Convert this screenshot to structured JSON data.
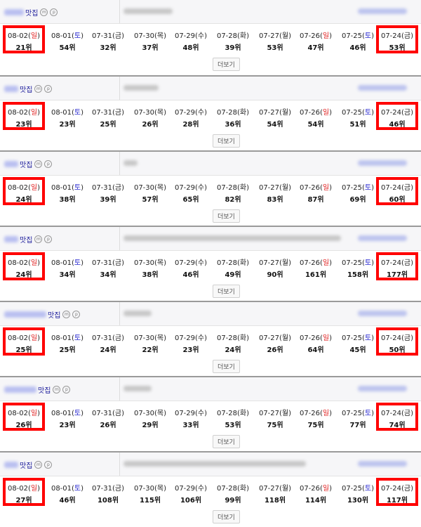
{
  "cards": [
    {
      "name_label": "맛집",
      "ranks": [
        "21위",
        "54위",
        "32위",
        "37위",
        "48위",
        "39위",
        "53위",
        "47위",
        "46위",
        "53위"
      ]
    },
    {
      "name_label": "맛집",
      "ranks": [
        "23위",
        "23위",
        "25위",
        "26위",
        "28위",
        "36위",
        "54위",
        "54위",
        "51위",
        "46위"
      ]
    },
    {
      "name_label": "맛집",
      "ranks": [
        "24위",
        "38위",
        "39위",
        "57위",
        "65위",
        "82위",
        "83위",
        "87위",
        "69위",
        "60위"
      ]
    },
    {
      "name_label": "맛집",
      "ranks": [
        "24위",
        "34위",
        "34위",
        "38위",
        "46위",
        "49위",
        "90위",
        "161위",
        "158위",
        "177위"
      ]
    },
    {
      "name_label": "맛집",
      "ranks": [
        "25위",
        "25위",
        "24위",
        "22위",
        "23위",
        "24위",
        "26위",
        "64위",
        "45위",
        "50위"
      ]
    },
    {
      "name_label": "맛집",
      "ranks": [
        "26위",
        "23위",
        "26위",
        "29위",
        "33위",
        "53위",
        "75위",
        "75위",
        "77위",
        "74위"
      ]
    },
    {
      "name_label": "맛집",
      "ranks": [
        "27위",
        "46위",
        "108위",
        "115위",
        "106위",
        "99위",
        "118위",
        "114위",
        "130위",
        "117위"
      ]
    }
  ],
  "dates": [
    {
      "md": "08-02",
      "wk": "일",
      "type": "sun"
    },
    {
      "md": "08-01",
      "wk": "토",
      "type": "sat"
    },
    {
      "md": "07-31",
      "wk": "금",
      "type": ""
    },
    {
      "md": "07-30",
      "wk": "목",
      "type": ""
    },
    {
      "md": "07-29",
      "wk": "수",
      "type": ""
    },
    {
      "md": "07-28",
      "wk": "화",
      "type": ""
    },
    {
      "md": "07-27",
      "wk": "월",
      "type": ""
    },
    {
      "md": "07-26",
      "wk": "일",
      "type": "sun"
    },
    {
      "md": "07-25",
      "wk": "토",
      "type": "sat"
    },
    {
      "md": "07-24",
      "wk": "금",
      "type": ""
    }
  ],
  "badges": [
    "m",
    "p"
  ],
  "more_label": "더보기",
  "colors": {
    "highlight": "#ff0000",
    "sunday": "#e02020",
    "saturday": "#2a2ad0"
  }
}
